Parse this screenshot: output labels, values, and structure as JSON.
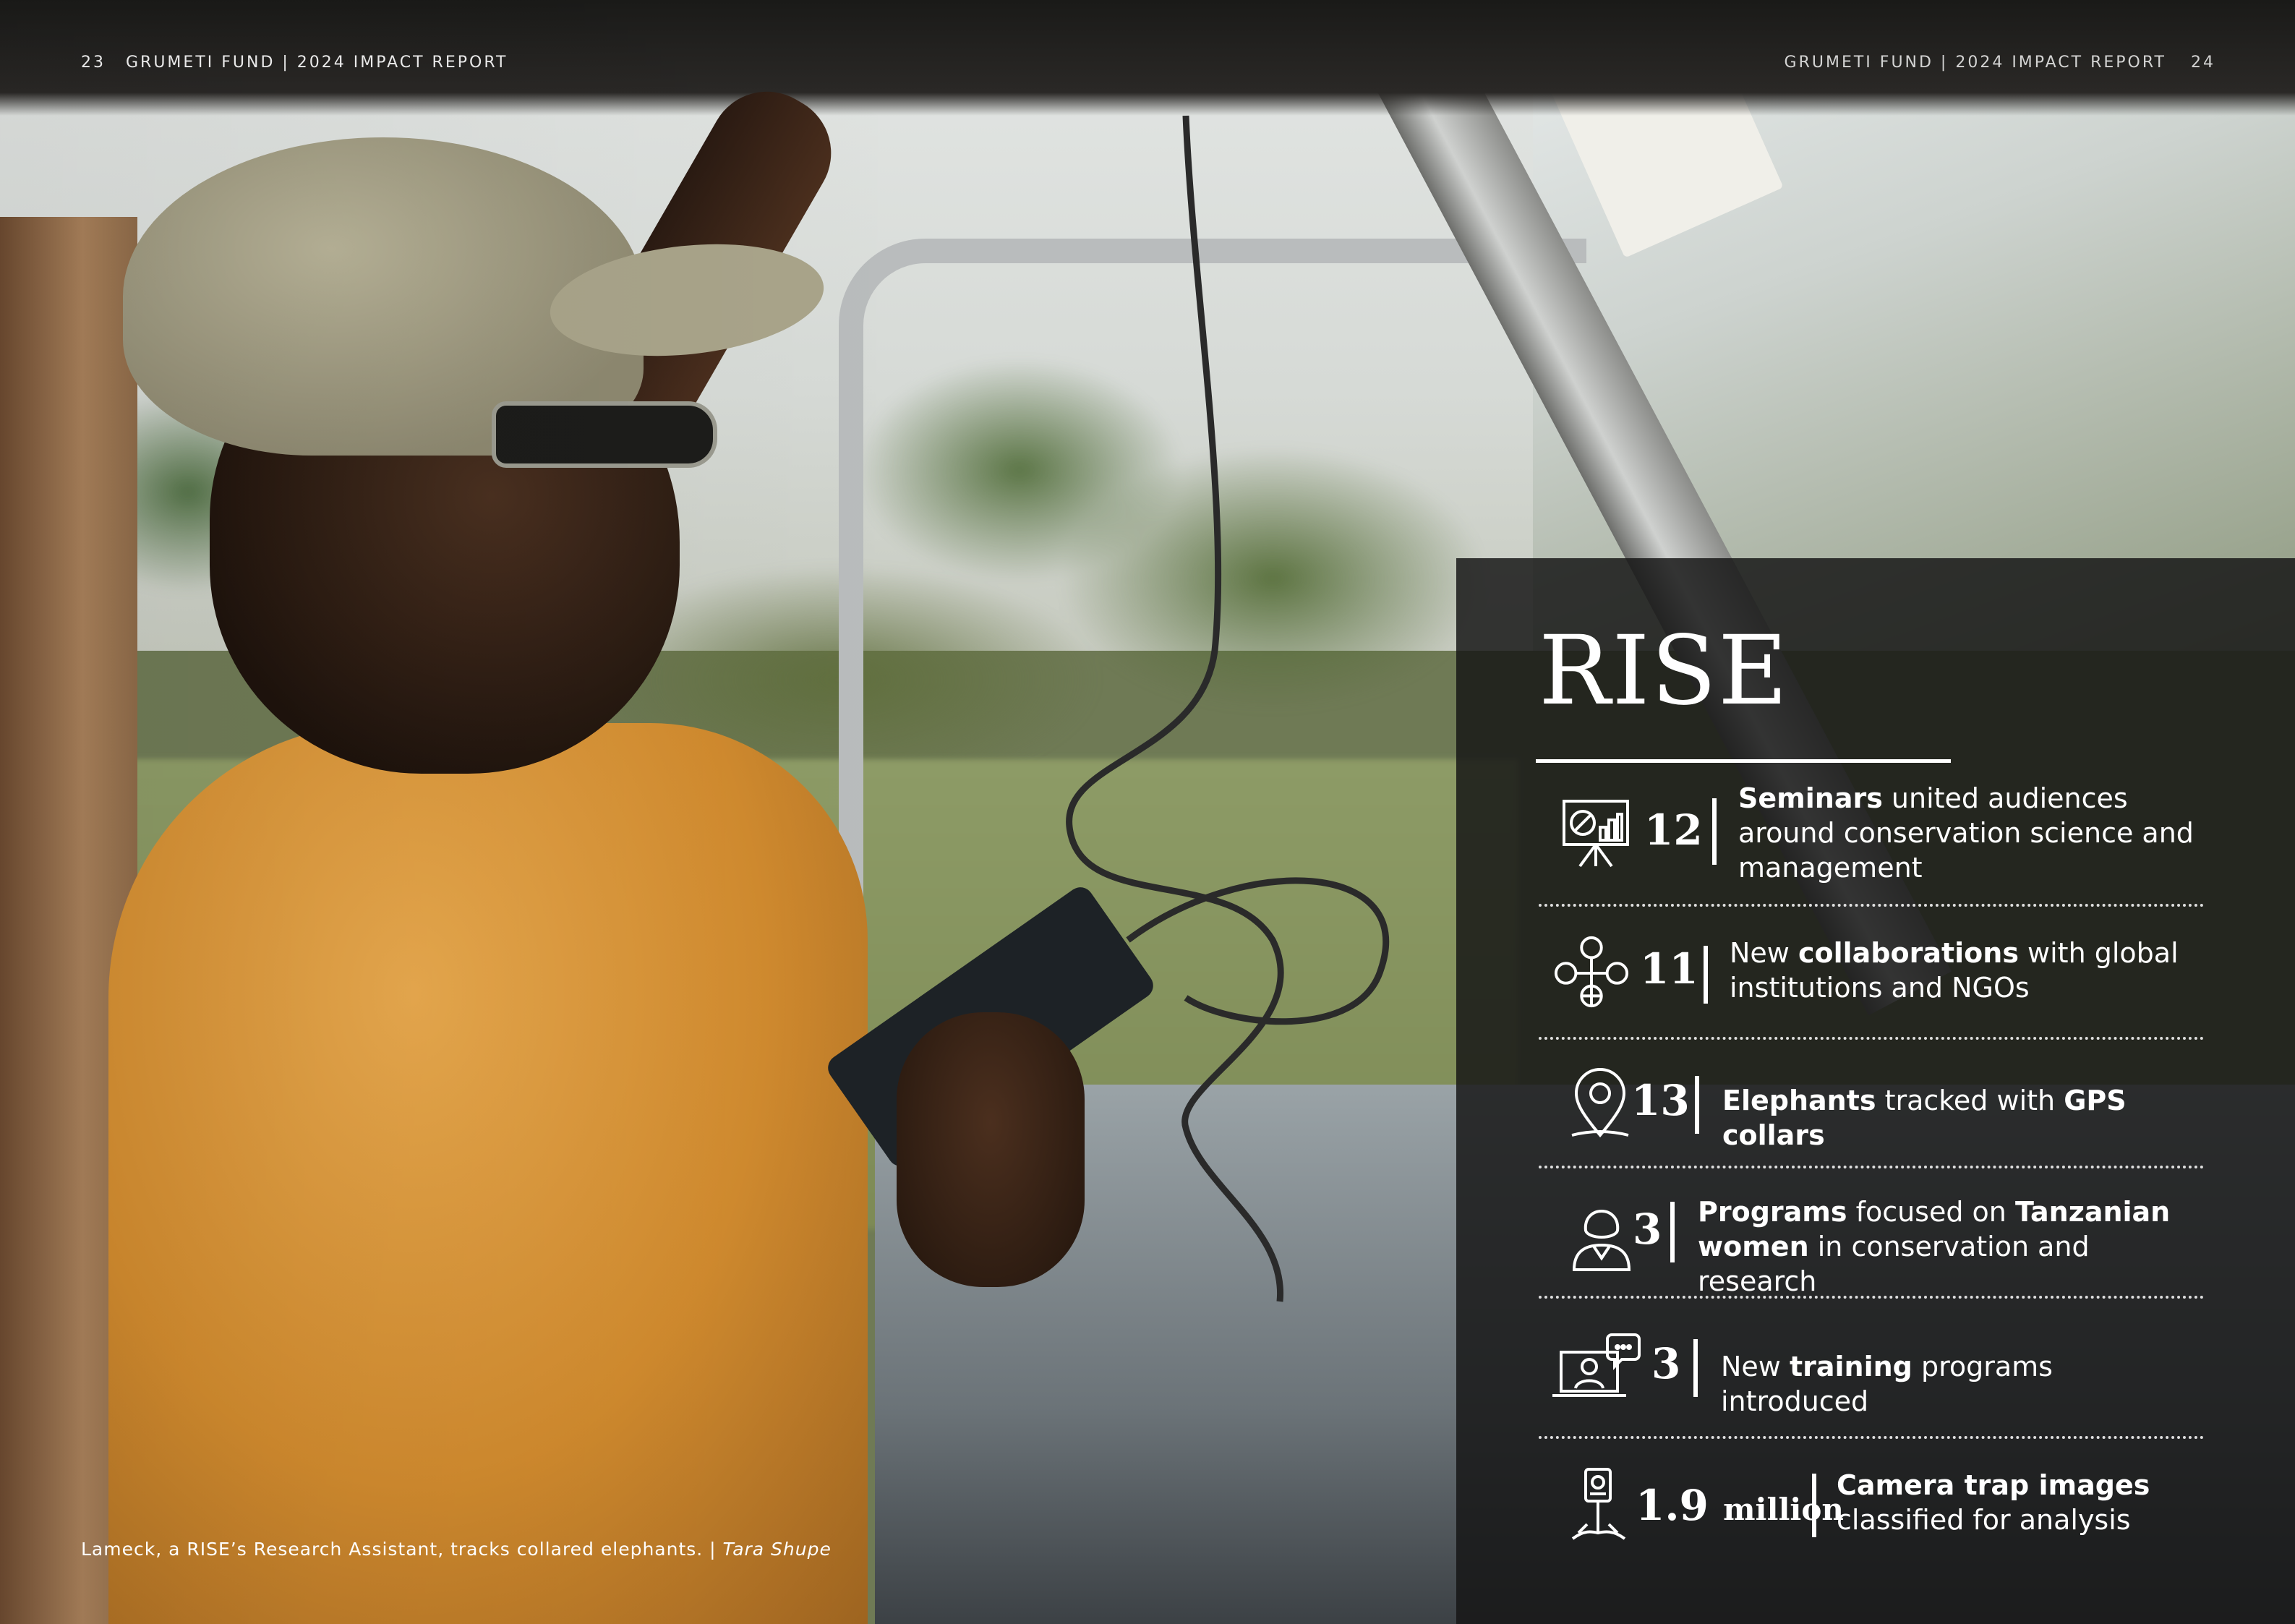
{
  "header": {
    "left_page": "23",
    "left_title": "GRUMETI FUND | 2024 IMPACT REPORT",
    "right_title": "GRUMETI FUND | 2024 IMPACT REPORT",
    "right_page": "24"
  },
  "caption": {
    "text": "Lameck, a RISE’s Research Assistant, tracks collared elephants. | ",
    "credit": "Tara Shupe"
  },
  "panel": {
    "title": "RISE",
    "stats": [
      {
        "icon": "presentation-board-icon",
        "value": "12",
        "parts": [
          {
            "bold": "Seminars"
          },
          {
            "text": " united audiences around conservation science and management"
          }
        ]
      },
      {
        "icon": "global-collaboration-icon",
        "value": "11",
        "parts": [
          {
            "text": "New "
          },
          {
            "bold": "collaborations"
          },
          {
            "text": " with global institutions and NGOs"
          }
        ]
      },
      {
        "icon": "location-pin-icon",
        "value": "13",
        "parts": [
          {
            "bold": "Elephants"
          },
          {
            "text": " tracked with "
          },
          {
            "bold": "GPS collars"
          }
        ]
      },
      {
        "icon": "woman-professional-icon",
        "value": "3",
        "parts": [
          {
            "bold": "Programs"
          },
          {
            "text": " focused on "
          },
          {
            "bold": "Tanzanian women"
          },
          {
            "text": " in conservation and research"
          }
        ]
      },
      {
        "icon": "online-training-icon",
        "value": "3",
        "parts": [
          {
            "text": "New "
          },
          {
            "bold": "training"
          },
          {
            "text": " programs introduced"
          }
        ]
      },
      {
        "icon": "camera-trap-icon",
        "value": "1.9",
        "unit": "million",
        "parts": [
          {
            "bold": "Camera trap images"
          },
          {
            "text": " classified for analysis"
          }
        ]
      }
    ]
  }
}
